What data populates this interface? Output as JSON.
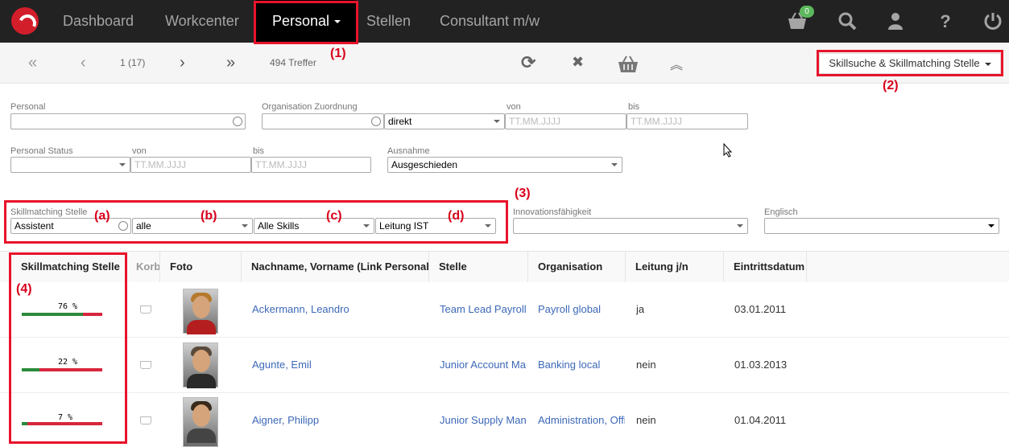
{
  "nav": {
    "items": [
      "Dashboard",
      "Workcenter",
      "Personal",
      "Stellen",
      "Consultant m/w"
    ],
    "active": "Personal",
    "basket_count": "0",
    "icons": [
      "basket-icon",
      "search-icon",
      "user-icon",
      "help-icon",
      "power-icon"
    ]
  },
  "toolbar": {
    "page": "1 (17)",
    "hits": "494 Treffer",
    "first": "«",
    "prev": "‹",
    "next": "›",
    "last": "»",
    "refresh": "⟳",
    "close": "✖",
    "collapse": "︽",
    "view_select": "Skillsuche & Skillmatching Stelle"
  },
  "annotations": {
    "n1": "(1)",
    "n2": "(2)",
    "n3": "(3)",
    "n4": "(4)",
    "a": "(a)",
    "b": "(b)",
    "c": "(c)",
    "d": "(d)"
  },
  "filters": {
    "personal_label": "Personal",
    "org_label": "Organisation Zuordnung",
    "org_mode": "direkt",
    "von_label": "von",
    "bis_label": "bis",
    "date_placeholder": "TT.MM.JJJJ",
    "status_label": "Personal Status",
    "ausnahme_label": "Ausnahme",
    "ausnahme_value": "Ausgeschieden",
    "skill_label": "Skillmatching Stelle",
    "skill_stelle": "Assistent",
    "skill_scope": "alle",
    "skill_set": "Alle Skills",
    "skill_level": "Leitung IST",
    "innov_label": "Innovationsfähigkeit",
    "englisch_label": "Englisch"
  },
  "table": {
    "headers": [
      "Skillmatching Stelle",
      "Korb",
      "Foto",
      "Nachname, Vorname (Link Personal)",
      "Stelle",
      "Organisation",
      "Leitung j/n",
      "Eintrittsdatum"
    ],
    "rows": [
      {
        "match": "76 %",
        "match_value": 76,
        "name": "Ackermann, Leandro",
        "stelle": "Team Lead Payroll",
        "org": "Payroll global",
        "leitung": "ja",
        "eintritt": "03.01.2011"
      },
      {
        "match": "22 %",
        "match_value": 22,
        "name": "Agunte, Emil",
        "stelle": "Junior Account Manager",
        "org": "Banking local",
        "leitung": "nein",
        "eintritt": "01.03.2013"
      },
      {
        "match": "7 %",
        "match_value": 7,
        "name": "Aigner, Philipp",
        "stelle": "Junior Supply Manager",
        "org": "Administration, Office",
        "leitung": "nein",
        "eintritt": "01.04.2011"
      }
    ]
  },
  "colors": {
    "nav_bg": "#222222",
    "annotation_red": "#e8132b",
    "link": "#3c68b7",
    "match_good": "#2c8a3a",
    "match_bad": "#d7263d"
  }
}
